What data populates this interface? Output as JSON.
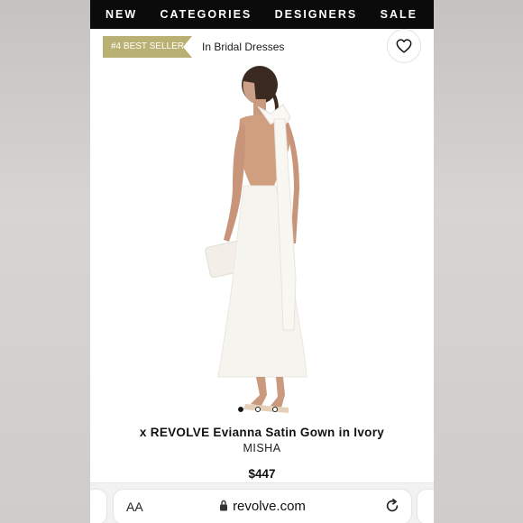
{
  "nav": {
    "items": [
      {
        "label": "NEW"
      },
      {
        "label": "CATEGORIES"
      },
      {
        "label": "DESIGNERS"
      },
      {
        "label": "SALE"
      }
    ]
  },
  "badge": {
    "best_seller": "#4 BEST SELLER",
    "category": "In Bridal Dresses"
  },
  "product": {
    "title": "x REVOLVE Evianna Satin Gown in Ivory",
    "designer": "MISHA",
    "price": "$447",
    "image_count": 3,
    "active_image": 1
  },
  "browser": {
    "text_size_label": "AA",
    "url": "revolve.com"
  },
  "colors": {
    "nav_bg": "#0b0b0b",
    "badge_bg": "#b9b173",
    "page_bg": "#ffffff"
  },
  "icons": {
    "wishlist": "heart-icon",
    "secure": "lock-icon",
    "reload": "reload-icon"
  }
}
